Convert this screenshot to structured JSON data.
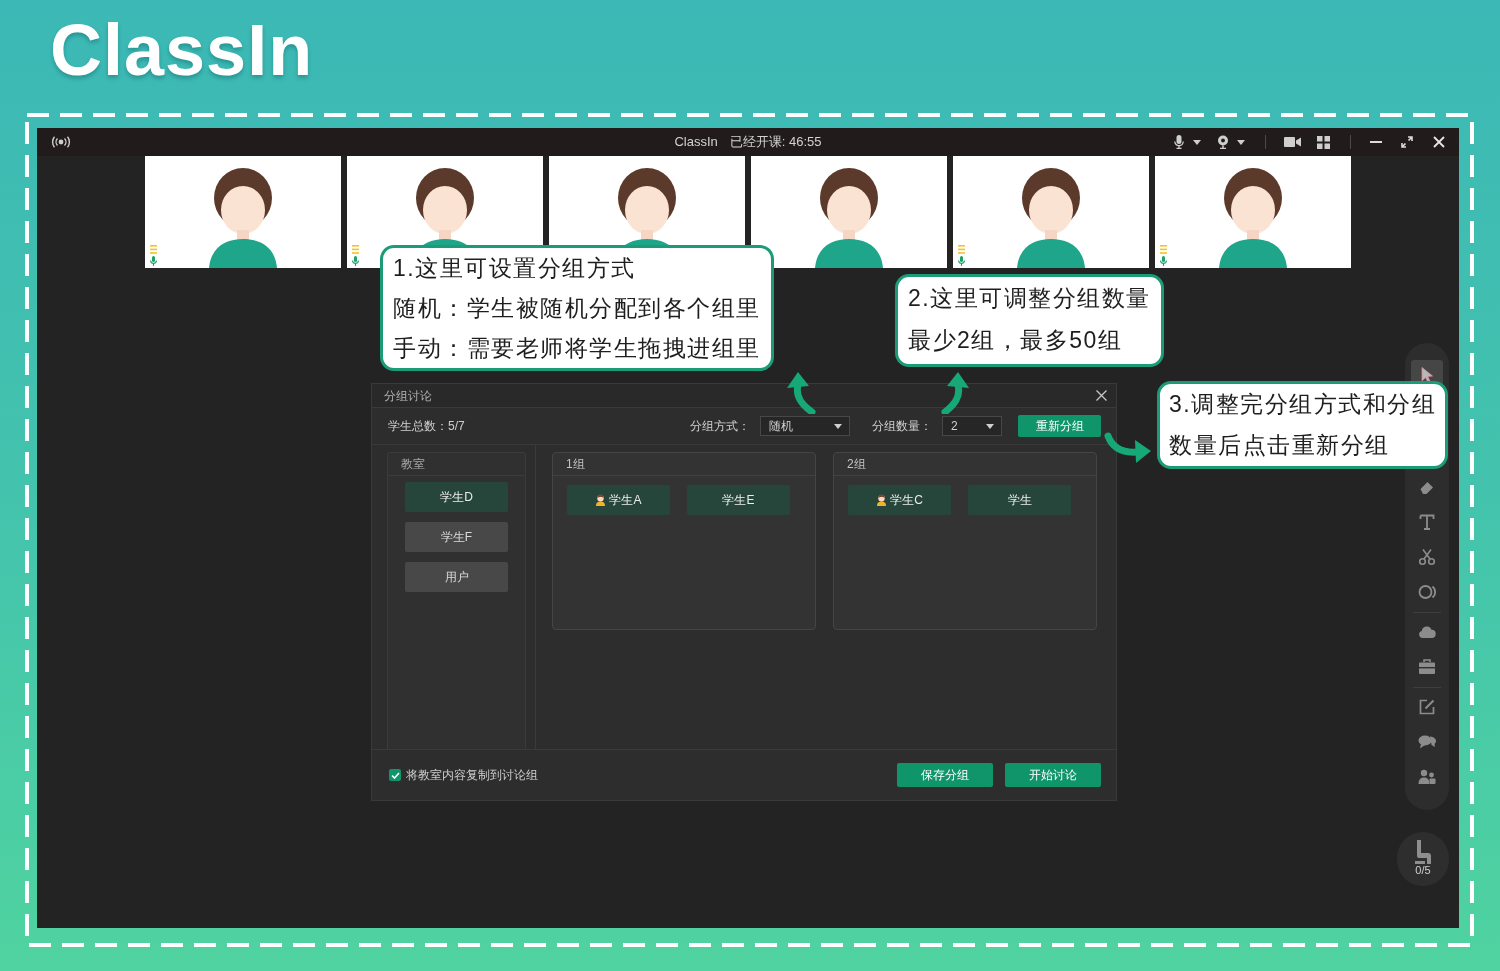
{
  "logo": {
    "text": "ClassIn"
  },
  "window": {
    "title": "ClassIn",
    "elapsed": "已经开课: 46:55"
  },
  "video_tiles": [
    {
      "mic_indicator": true
    },
    {
      "mic_indicator": true
    },
    {
      "mic_indicator": false
    },
    {
      "mic_indicator": false
    },
    {
      "mic_indicator": true
    },
    {
      "mic_indicator": true
    }
  ],
  "dialog": {
    "title": "分组讨论",
    "student_total": "学生总数：5/7",
    "mode": {
      "label": "分组方式：",
      "value": "随机"
    },
    "count": {
      "label": "分组数量：",
      "value": "2"
    },
    "regroup_button": "重新分组",
    "classroom": {
      "title": "教室",
      "students": [
        {
          "name": "学生D",
          "online": true
        },
        {
          "name": "学生F",
          "online": false
        },
        {
          "name": "用户",
          "online": false
        }
      ]
    },
    "groups": [
      {
        "title": "1组",
        "members": [
          {
            "name": "学生A",
            "avatar_icon": true,
            "online": true
          },
          {
            "name": "学生E",
            "avatar_icon": false,
            "online": true
          }
        ]
      },
      {
        "title": "2组",
        "members": [
          {
            "name": "学生C",
            "avatar_icon": true,
            "online": true
          },
          {
            "name": "学生",
            "avatar_icon": false,
            "online": true
          }
        ]
      }
    ],
    "copy_option": {
      "label": "将教室内容复制到讨论组",
      "checked": true
    },
    "buttons": [
      "保存分组",
      "开始讨论"
    ]
  },
  "toolbar": {
    "groups": [
      [
        {
          "kind": "cursor",
          "selected": true
        }
      ],
      [
        {
          "kind": "eraser",
          "selected": false
        },
        {
          "kind": "text",
          "selected": false
        },
        {
          "kind": "scissors",
          "selected": false
        },
        {
          "kind": "shape",
          "selected": false
        }
      ],
      [
        {
          "kind": "cloud",
          "selected": false
        },
        {
          "kind": "toolbox",
          "selected": false
        }
      ],
      [
        {
          "kind": "edit",
          "selected": false
        },
        {
          "kind": "chat",
          "selected": false
        },
        {
          "kind": "users",
          "selected": false
        }
      ]
    ]
  },
  "hand_raise": {
    "count": "0/5"
  },
  "callouts": [
    {
      "lines": [
        "1.这里可设置分组方式",
        "随机：学生被随机分配到各个组里",
        "手动：需要老师将学生拖拽进组里"
      ]
    },
    {
      "lines": [
        "2.这里可调整分组数量",
        "最少2组，最多50组"
      ]
    },
    {
      "lines": [
        "3.调整完分组方式和分组",
        "数量后点击重新分组"
      ]
    }
  ]
}
